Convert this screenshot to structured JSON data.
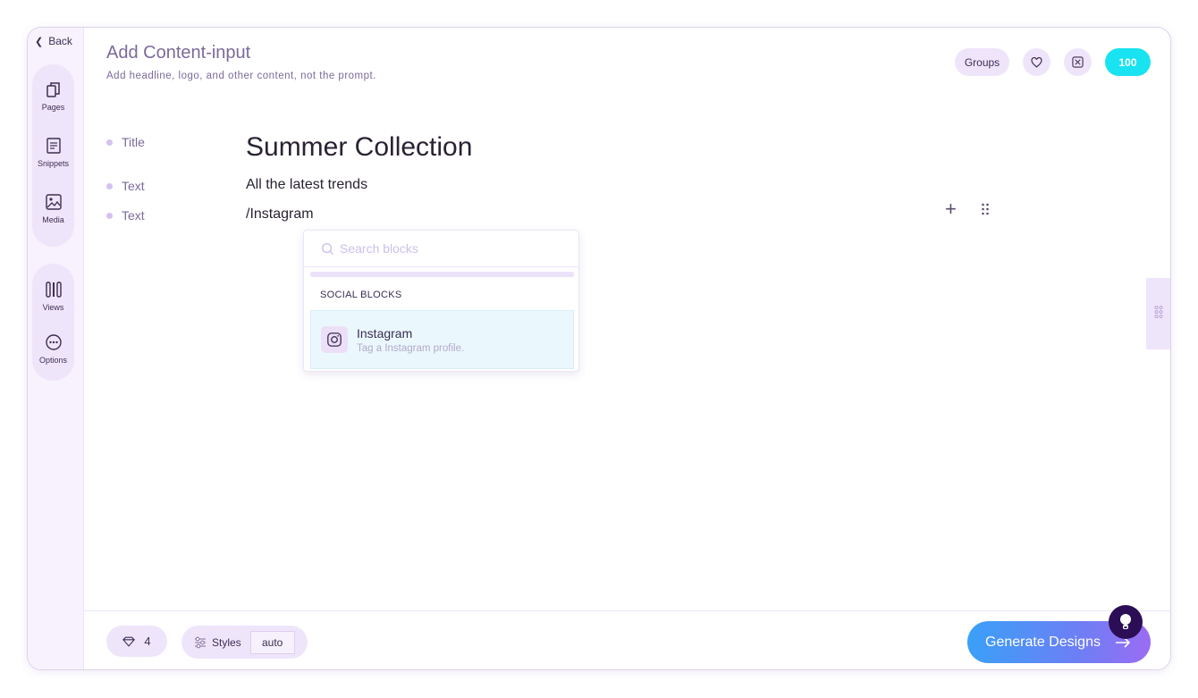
{
  "sidebar": {
    "back_label": "Back",
    "items": [
      {
        "label": "Pages",
        "icon": "pages-icon"
      },
      {
        "label": "Snippets",
        "icon": "snippets-icon"
      },
      {
        "label": "Media",
        "icon": "media-icon"
      },
      {
        "label": "Views",
        "icon": "views-icon"
      },
      {
        "label": "Options",
        "icon": "options-icon"
      }
    ]
  },
  "header": {
    "title": "Add Content-input",
    "subtitle": "Add headline, logo, and other content, not the prompt.",
    "groups_label": "Groups",
    "credits": "100"
  },
  "content": {
    "rows": [
      {
        "label": "Title",
        "value": "Summer Collection"
      },
      {
        "label": "Text",
        "value": "All the latest trends"
      },
      {
        "label": "Text",
        "value": "/Instagram"
      }
    ]
  },
  "block_menu": {
    "search_placeholder": "Search blocks",
    "section_label": "SOCIAL BLOCKS",
    "items": [
      {
        "title": "Instagram",
        "description": "Tag a Instagram profile.",
        "icon": "instagram-icon"
      }
    ]
  },
  "footer": {
    "gem_count": "4",
    "styles_label": "Styles",
    "styles_value": "auto",
    "generate_label": "Generate Designs"
  },
  "colors": {
    "accent": "#efe5fb",
    "credits": "#19e3f0",
    "generate_gradient_start": "#3aa0f8",
    "generate_gradient_end": "#9b6cf3"
  }
}
